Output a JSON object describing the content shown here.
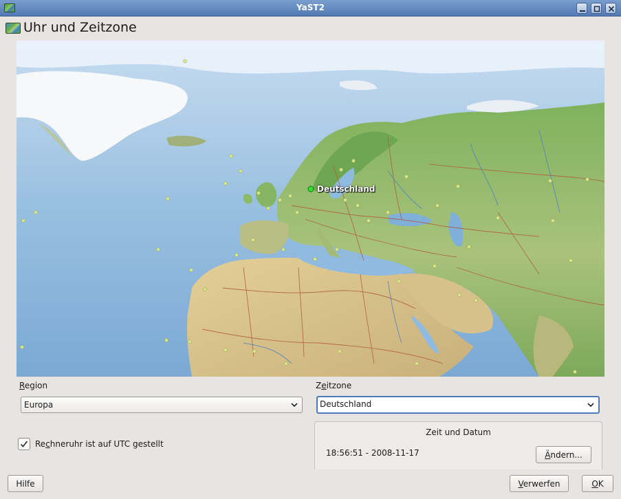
{
  "window": {
    "title": "YaST2",
    "colors": {
      "titlebar": "#5b82bb",
      "background": "#e8e4e1",
      "focus": "#4a7bc0"
    }
  },
  "header": {
    "title": "Uhr und Zeitzone",
    "icon": "world-map-icon"
  },
  "map": {
    "selected_label": "Deutschland"
  },
  "region": {
    "label_pre": "",
    "label_mnemonic": "R",
    "label_post": "egion",
    "value": "Europa"
  },
  "timezone": {
    "label_pre": "Z",
    "label_mnemonic": "e",
    "label_post": "itzone",
    "value": "Deutschland"
  },
  "utc_checkbox": {
    "checked": true,
    "label_pre": "Re",
    "label_mnemonic": "c",
    "label_post": "hneruhr ist auf UTC gestellt"
  },
  "time_group": {
    "title": "Zeit und Datum",
    "datetime": "18:56:51 - 2008-11-17",
    "change_pre": "",
    "change_mnemonic": "Ä",
    "change_post": "ndern..."
  },
  "footer": {
    "help": "Hilfe",
    "discard_pre": "",
    "discard_mnemonic": "V",
    "discard_post": "erwerfen",
    "ok_pre": "",
    "ok_mnemonic": "O",
    "ok_post": "K"
  }
}
